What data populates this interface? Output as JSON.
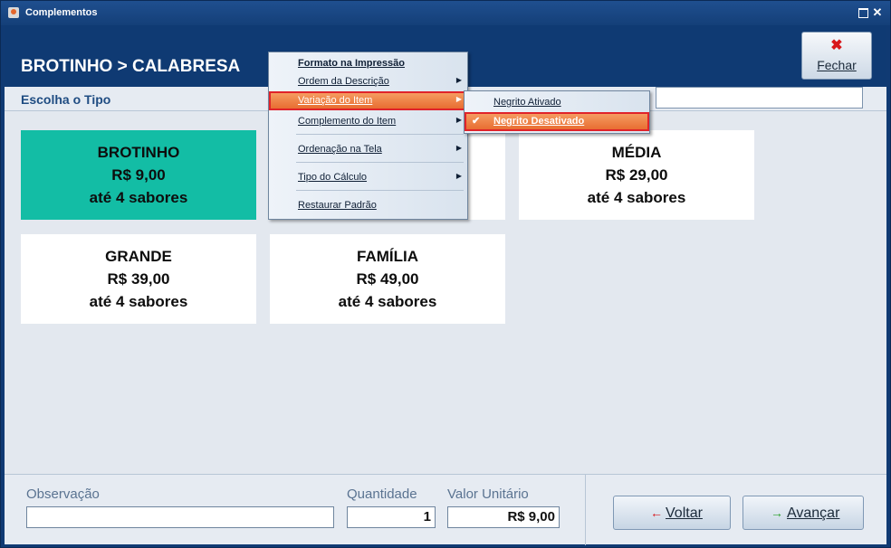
{
  "window": {
    "title": "Complementos"
  },
  "header": {
    "breadcrumb": "BROTINHO > CALABRESA",
    "close_label": "Fechar"
  },
  "section": {
    "title": "Escolha o Tipo",
    "search_value": ""
  },
  "cards": [
    {
      "name": "BROTINHO",
      "price": "R$ 9,00",
      "flavors": "até 4 sabores",
      "selected": true
    },
    {
      "name": "MÉDIA",
      "price": "R$ 29,00",
      "flavors": "até 4 sabores",
      "selected": false
    },
    {
      "name": "GRANDE",
      "price": "R$ 39,00",
      "flavors": "até 4 sabores",
      "selected": false
    },
    {
      "name": "FAMÍLIA",
      "price": "R$ 49,00",
      "flavors": "até 4 sabores",
      "selected": false
    }
  ],
  "context_menu": {
    "items": [
      {
        "label": "Formato na Impressão",
        "bold": true,
        "submenu": false
      },
      {
        "label": "Ordem da Descrição",
        "submenu": true
      },
      {
        "label": "Variação do Item",
        "submenu": true,
        "highlighted": true
      },
      {
        "label": "Complemento do Item",
        "submenu": true
      },
      {
        "label": "Ordenação na Tela",
        "submenu": true
      },
      {
        "label": "Tipo do Cálculo",
        "submenu": true
      },
      {
        "label": "Restaurar Padrão",
        "submenu": false
      }
    ]
  },
  "submenu": {
    "items": [
      {
        "label": "Negrito Ativado",
        "checked": false
      },
      {
        "label": "Negrito Desativado",
        "checked": true,
        "highlighted": true
      }
    ]
  },
  "footer": {
    "observacao_label": "Observação",
    "observacao_value": "",
    "quantidade_label": "Quantidade",
    "quantidade_value": "1",
    "valor_label": "Valor Unitário",
    "valor_value": "R$ 9,00",
    "voltar_label": "Voltar",
    "avancar_label": "Avançar"
  },
  "colors": {
    "header_bg": "#0f3a73",
    "selected_card": "#13bda5",
    "menu_highlight": "#e6682c",
    "highlight_outline": "#e0232a"
  }
}
